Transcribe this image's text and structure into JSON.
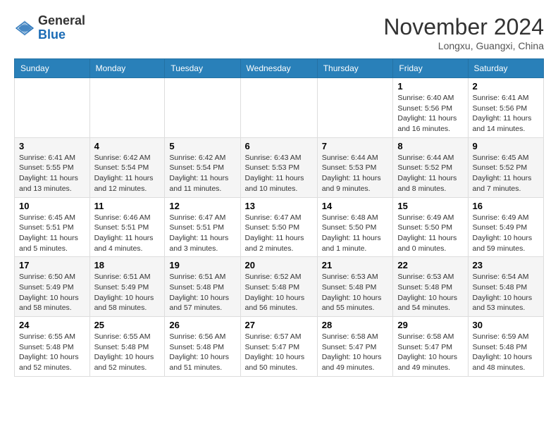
{
  "header": {
    "logo_general": "General",
    "logo_blue": "Blue",
    "month_title": "November 2024",
    "location": "Longxu, Guangxi, China"
  },
  "days_of_week": [
    "Sunday",
    "Monday",
    "Tuesday",
    "Wednesday",
    "Thursday",
    "Friday",
    "Saturday"
  ],
  "weeks": [
    [
      {
        "day": "",
        "info": ""
      },
      {
        "day": "",
        "info": ""
      },
      {
        "day": "",
        "info": ""
      },
      {
        "day": "",
        "info": ""
      },
      {
        "day": "",
        "info": ""
      },
      {
        "day": "1",
        "info": "Sunrise: 6:40 AM\nSunset: 5:56 PM\nDaylight: 11 hours and 16 minutes."
      },
      {
        "day": "2",
        "info": "Sunrise: 6:41 AM\nSunset: 5:56 PM\nDaylight: 11 hours and 14 minutes."
      }
    ],
    [
      {
        "day": "3",
        "info": "Sunrise: 6:41 AM\nSunset: 5:55 PM\nDaylight: 11 hours and 13 minutes."
      },
      {
        "day": "4",
        "info": "Sunrise: 6:42 AM\nSunset: 5:54 PM\nDaylight: 11 hours and 12 minutes."
      },
      {
        "day": "5",
        "info": "Sunrise: 6:42 AM\nSunset: 5:54 PM\nDaylight: 11 hours and 11 minutes."
      },
      {
        "day": "6",
        "info": "Sunrise: 6:43 AM\nSunset: 5:53 PM\nDaylight: 11 hours and 10 minutes."
      },
      {
        "day": "7",
        "info": "Sunrise: 6:44 AM\nSunset: 5:53 PM\nDaylight: 11 hours and 9 minutes."
      },
      {
        "day": "8",
        "info": "Sunrise: 6:44 AM\nSunset: 5:52 PM\nDaylight: 11 hours and 8 minutes."
      },
      {
        "day": "9",
        "info": "Sunrise: 6:45 AM\nSunset: 5:52 PM\nDaylight: 11 hours and 7 minutes."
      }
    ],
    [
      {
        "day": "10",
        "info": "Sunrise: 6:45 AM\nSunset: 5:51 PM\nDaylight: 11 hours and 5 minutes."
      },
      {
        "day": "11",
        "info": "Sunrise: 6:46 AM\nSunset: 5:51 PM\nDaylight: 11 hours and 4 minutes."
      },
      {
        "day": "12",
        "info": "Sunrise: 6:47 AM\nSunset: 5:51 PM\nDaylight: 11 hours and 3 minutes."
      },
      {
        "day": "13",
        "info": "Sunrise: 6:47 AM\nSunset: 5:50 PM\nDaylight: 11 hours and 2 minutes."
      },
      {
        "day": "14",
        "info": "Sunrise: 6:48 AM\nSunset: 5:50 PM\nDaylight: 11 hours and 1 minute."
      },
      {
        "day": "15",
        "info": "Sunrise: 6:49 AM\nSunset: 5:50 PM\nDaylight: 11 hours and 0 minutes."
      },
      {
        "day": "16",
        "info": "Sunrise: 6:49 AM\nSunset: 5:49 PM\nDaylight: 10 hours and 59 minutes."
      }
    ],
    [
      {
        "day": "17",
        "info": "Sunrise: 6:50 AM\nSunset: 5:49 PM\nDaylight: 10 hours and 58 minutes."
      },
      {
        "day": "18",
        "info": "Sunrise: 6:51 AM\nSunset: 5:49 PM\nDaylight: 10 hours and 58 minutes."
      },
      {
        "day": "19",
        "info": "Sunrise: 6:51 AM\nSunset: 5:48 PM\nDaylight: 10 hours and 57 minutes."
      },
      {
        "day": "20",
        "info": "Sunrise: 6:52 AM\nSunset: 5:48 PM\nDaylight: 10 hours and 56 minutes."
      },
      {
        "day": "21",
        "info": "Sunrise: 6:53 AM\nSunset: 5:48 PM\nDaylight: 10 hours and 55 minutes."
      },
      {
        "day": "22",
        "info": "Sunrise: 6:53 AM\nSunset: 5:48 PM\nDaylight: 10 hours and 54 minutes."
      },
      {
        "day": "23",
        "info": "Sunrise: 6:54 AM\nSunset: 5:48 PM\nDaylight: 10 hours and 53 minutes."
      }
    ],
    [
      {
        "day": "24",
        "info": "Sunrise: 6:55 AM\nSunset: 5:48 PM\nDaylight: 10 hours and 52 minutes."
      },
      {
        "day": "25",
        "info": "Sunrise: 6:55 AM\nSunset: 5:48 PM\nDaylight: 10 hours and 52 minutes."
      },
      {
        "day": "26",
        "info": "Sunrise: 6:56 AM\nSunset: 5:48 PM\nDaylight: 10 hours and 51 minutes."
      },
      {
        "day": "27",
        "info": "Sunrise: 6:57 AM\nSunset: 5:47 PM\nDaylight: 10 hours and 50 minutes."
      },
      {
        "day": "28",
        "info": "Sunrise: 6:58 AM\nSunset: 5:47 PM\nDaylight: 10 hours and 49 minutes."
      },
      {
        "day": "29",
        "info": "Sunrise: 6:58 AM\nSunset: 5:47 PM\nDaylight: 10 hours and 49 minutes."
      },
      {
        "day": "30",
        "info": "Sunrise: 6:59 AM\nSunset: 5:48 PM\nDaylight: 10 hours and 48 minutes."
      }
    ]
  ]
}
